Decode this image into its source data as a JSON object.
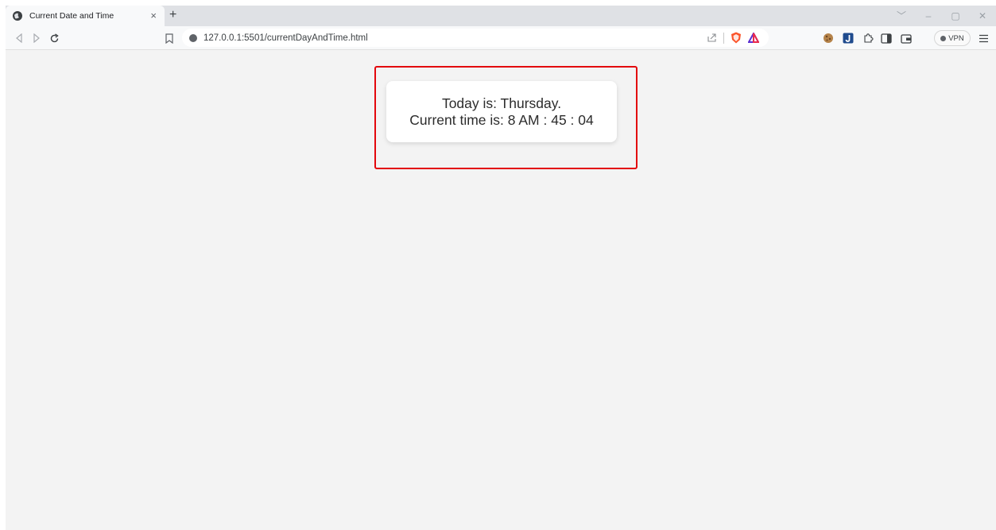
{
  "tab": {
    "title": "Current Date and Time",
    "close_label": "×",
    "new_tab_label": "+"
  },
  "window_controls": {
    "tab_search": "﹀",
    "minimize": "–",
    "restore": "▢",
    "close": "✕"
  },
  "omnibox": {
    "url": "127.0.0.1:5501/currentDayAndTime.html"
  },
  "toolbar": {
    "vpn_label": "VPN"
  },
  "content": {
    "day_line": "Today is: Thursday.",
    "time_line": "Current time is: 8 AM : 45 : 04"
  },
  "colors": {
    "highlight_border": "#e3060c",
    "brave_orange": "#fb542b",
    "rewards_purple": "#5a2fd1",
    "extension_blue": "#1f4b8e"
  }
}
